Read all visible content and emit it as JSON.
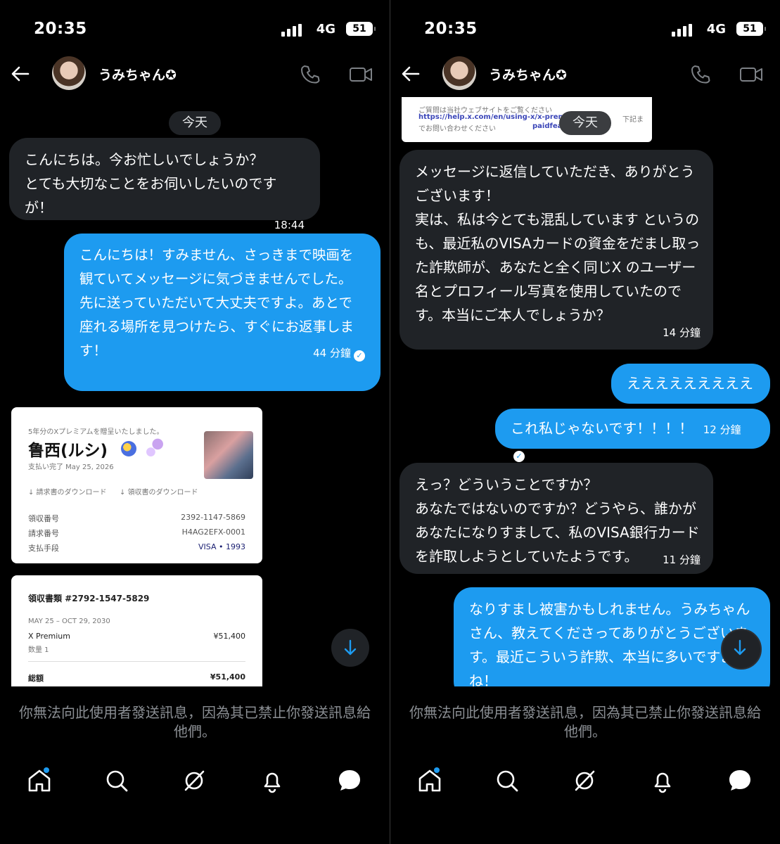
{
  "status": {
    "time": "20:35",
    "network": "4G",
    "battery": "51"
  },
  "contact": {
    "name": "うみちゃん✪"
  },
  "composer_blocked": "你無法向此使用者發送訊息，因為其已禁止你發送訊息給他們。",
  "left": {
    "date_label": "今天",
    "messages": [
      {
        "text": "こんにちは。今お忙しいでしょうか？\nとても大切なことをお伺いしたいのですが！",
        "time": "18:44"
      },
      {
        "text": "こんにちは！すみません、さっきまで映画を観ていてメッセージに気づきませんでした。\n先に送っていただいて大丈夫ですよ。あとで座れる場所を見つけたら、すぐにお返事します！",
        "time": "44 分鐘"
      }
    ],
    "receipt1": {
      "heading": "5年分のXプレミアムを贈呈いたしました。",
      "name": "鲁西(ルシ)",
      "paid": "支払い完了 May 25, 2026",
      "dl_invoice": "↓ 請求書のダウンロード",
      "dl_receipt": "↓ 領収書のダウンロード",
      "rows": [
        {
          "label": "領収番号",
          "value": "2392-1147-5869"
        },
        {
          "label": "請求番号",
          "value": "H4AG2EFX-0001"
        },
        {
          "label": "支払手段",
          "value": "VISA • 1993"
        }
      ]
    },
    "receipt2": {
      "title": "領収書類 #2792-1547-5829",
      "period": "MAY 25 – OCT 29, 2030",
      "item": "X Premium",
      "item_price": "¥51,400",
      "qty": "数量 1",
      "total_label": "総額",
      "total_value": "¥51,400"
    }
  },
  "right": {
    "date_label": "今天",
    "snippet": {
      "line1": "ご質問は当社ウェブサイトをご覧ください",
      "link1": "https://help.x.com/en/using-x/x-premium",
      "line2": "でお問い合わせください",
      "link2": "paidfeatures@x.c",
      "tail": "下記ま"
    },
    "messages": [
      {
        "text": "メッセージに返信していただき、ありがとうございます！\n実は、私は今とても混乱しています というのも、最近私のVISAカードの資金をだまし取った詐欺師が、あなたと全く同じX のユーザー名とプロフィール写真を使用していたのです。本当にご本人でしょうか？",
        "time": "14 分鐘"
      },
      {
        "text": "えええええええええ",
        "time": ""
      },
      {
        "text": "これ私じゃないです！！！！",
        "time": "12 分鐘"
      },
      {
        "text": "えっ？どういうことですか？\nあなたではないのですか？どうやら、誰かがあなたになりすまして、私のVISA銀行カードを詐取しようとしていたようです。",
        "time": "11 分鐘"
      },
      {
        "text": "なりすまし被害かもしれません。うみちゃんさん、教えてくださってありがとうございます。最近こういう詐欺、本当に多いですよね！",
        "time": ""
      }
    ]
  },
  "nav": [
    "home-icon",
    "search-icon",
    "grok-icon",
    "notifications-icon",
    "messages-icon"
  ],
  "colors": {
    "accent": "#1d9bf0",
    "incoming_bubble": "#202327",
    "background": "#000000"
  }
}
